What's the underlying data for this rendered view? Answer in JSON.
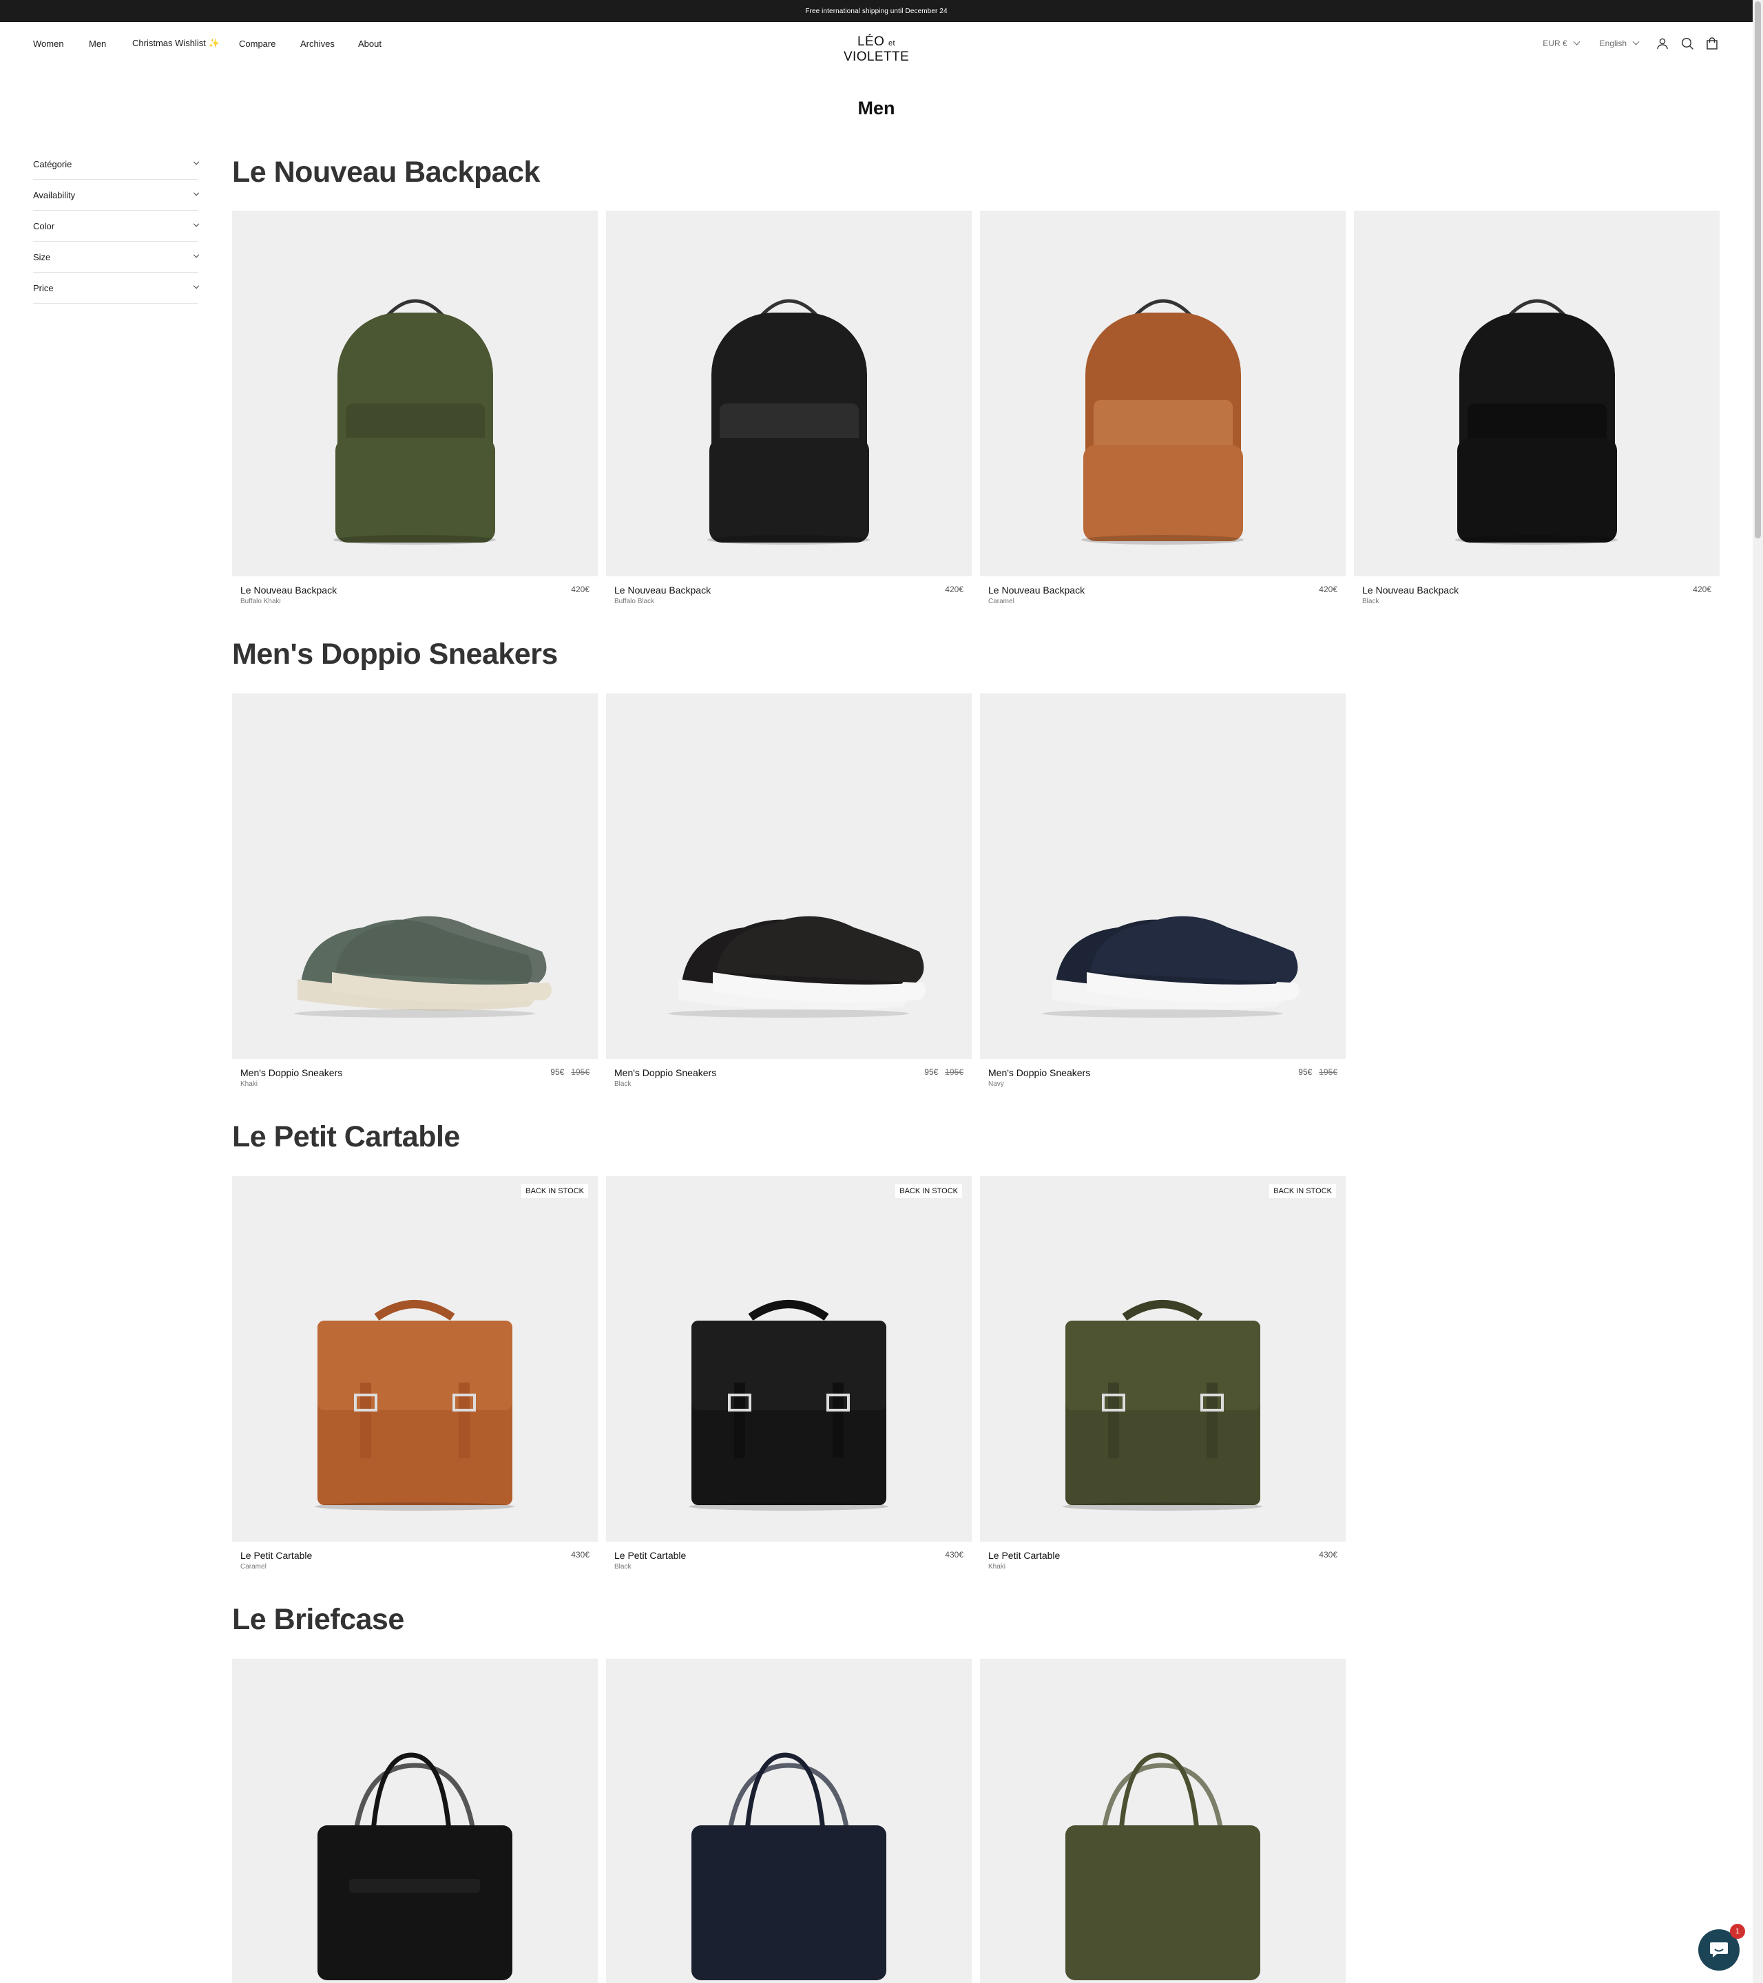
{
  "announcement": "Free international shipping until December 24",
  "nav": {
    "items": [
      "Women",
      "Men",
      "Christmas Wishlist ✨",
      "Compare",
      "Archives",
      "About"
    ],
    "logo_main_1": "LÉO",
    "logo_et": "et",
    "logo_main_2": "VIOLETTE",
    "currency": "EUR €",
    "language": "English",
    "icons": [
      "account-icon",
      "search-icon",
      "cart-icon"
    ]
  },
  "page_title": "Men",
  "filters": [
    "Catégorie",
    "Availability",
    "Color",
    "Size",
    "Price"
  ],
  "collections": [
    {
      "title": "Le Nouveau Backpack",
      "products": [
        {
          "name": "Le Nouveau Backpack",
          "variant": "Buffalo Khaki",
          "price": "420€",
          "color": "#4b5632"
        },
        {
          "name": "Le Nouveau Backpack",
          "variant": "Buffalo Black",
          "price": "420€",
          "color": "#1c1c1c"
        },
        {
          "name": "Le Nouveau Backpack",
          "variant": "Caramel",
          "price": "420€",
          "color": "#a85a2c"
        },
        {
          "name": "Le Nouveau Backpack",
          "variant": "Black",
          "price": "420€",
          "color": "#161616"
        }
      ]
    },
    {
      "title": "Men's Doppio Sneakers",
      "products": [
        {
          "name": "Men's Doppio Sneakers",
          "variant": "Khaki",
          "price": "95€",
          "old_price": "195€",
          "color": "#5b6a5f"
        },
        {
          "name": "Men's Doppio Sneakers",
          "variant": "Black",
          "price": "95€",
          "old_price": "195€",
          "color": "#1d1b1b"
        },
        {
          "name": "Men's Doppio Sneakers",
          "variant": "Navy",
          "price": "95€",
          "old_price": "195€",
          "color": "#1d2436"
        }
      ]
    },
    {
      "title": "Le Petit Cartable",
      "products": [
        {
          "name": "Le Petit Cartable",
          "variant": "Caramel",
          "price": "430€",
          "badge": "BACK IN STOCK",
          "color": "#b25d2c"
        },
        {
          "name": "Le Petit Cartable",
          "variant": "Black",
          "price": "430€",
          "badge": "BACK IN STOCK",
          "color": "#151515"
        },
        {
          "name": "Le Petit Cartable",
          "variant": "Khaki",
          "price": "430€",
          "badge": "BACK IN STOCK",
          "color": "#464a2c"
        }
      ]
    },
    {
      "title": "Le Briefcase",
      "products": [
        {
          "color": "#141414"
        },
        {
          "color": "#1a2030"
        },
        {
          "color": "#4a5030"
        }
      ]
    }
  ],
  "chat_unread": "1"
}
